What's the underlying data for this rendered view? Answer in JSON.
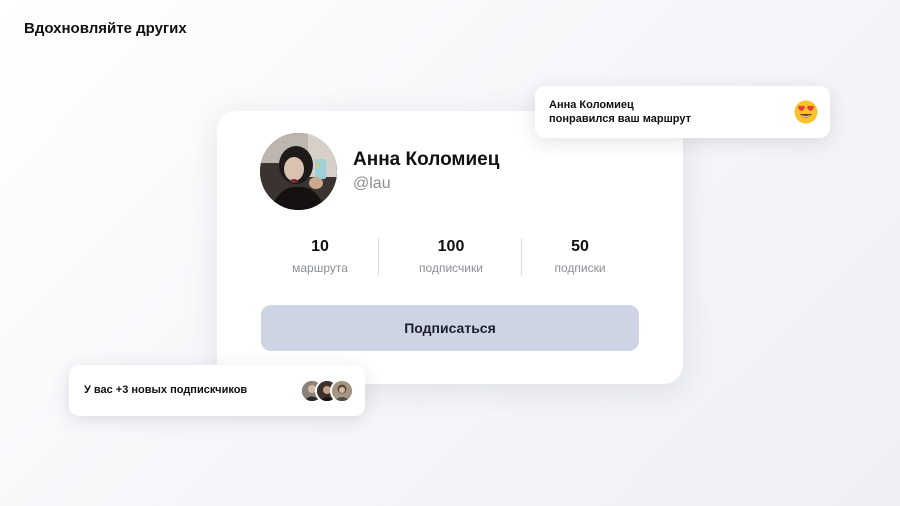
{
  "page": {
    "heading": "Вдохновляйте других"
  },
  "profile": {
    "name": "Анна Коломиец",
    "handle": "@lau",
    "avatar_icon": "user-photo",
    "stats": [
      {
        "value": "10",
        "label": "маршрута"
      },
      {
        "value": "100",
        "label": "подписчики"
      },
      {
        "value": "50",
        "label": "подписки"
      }
    ],
    "subscribe_label": "Подписаться"
  },
  "notification_like": {
    "line1": "Анна Коломиец",
    "line2": "понравился ваш маршрут",
    "emoji_icon": "heart-eyes-emoji"
  },
  "notification_followers": {
    "text": "У вас +3 новых подпискчиков",
    "avatar_count": 3
  },
  "colors": {
    "button_bg": "#cfd4e4",
    "muted_text": "#8b8f98",
    "emoji_yellow": "#f8c22a",
    "emoji_heart": "#e83a3a"
  }
}
